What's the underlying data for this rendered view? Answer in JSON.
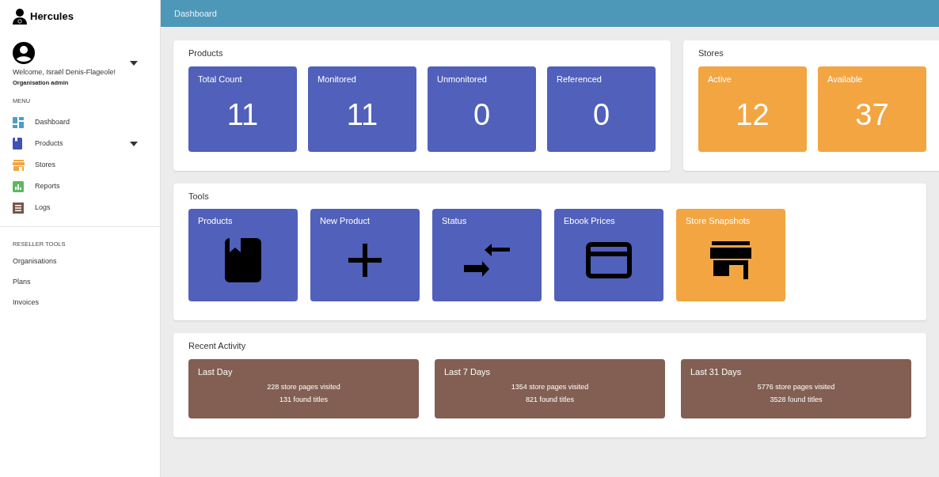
{
  "brand": "Hercules",
  "user": {
    "welcome": "Welcome, Israël Denis-Flageole!",
    "role": "Organisation admin"
  },
  "menu": {
    "heading": "MENU",
    "items": [
      {
        "label": "Dashboard",
        "has_submenu": false
      },
      {
        "label": "Products",
        "has_submenu": true
      },
      {
        "label": "Stores",
        "has_submenu": false
      },
      {
        "label": "Reports",
        "has_submenu": false
      },
      {
        "label": "Logs",
        "has_submenu": false
      }
    ]
  },
  "reseller": {
    "heading": "RESELLER TOOLS",
    "items": [
      "Organisations",
      "Plans",
      "Invoices"
    ]
  },
  "header": {
    "title": "Dashboard"
  },
  "products": {
    "title": "Products",
    "stats": [
      {
        "label": "Total Count",
        "value": "11"
      },
      {
        "label": "Monitored",
        "value": "11"
      },
      {
        "label": "Unmonitored",
        "value": "0"
      },
      {
        "label": "Referenced",
        "value": "0"
      }
    ]
  },
  "stores": {
    "title": "Stores",
    "stats": [
      {
        "label": "Active",
        "value": "12"
      },
      {
        "label": "Available",
        "value": "37"
      }
    ]
  },
  "tools": {
    "title": "Tools",
    "items": [
      {
        "label": "Products",
        "color": "#5060bb"
      },
      {
        "label": "New Product",
        "color": "#5060bb"
      },
      {
        "label": "Status",
        "color": "#5060bb"
      },
      {
        "label": "Ebook Prices",
        "color": "#5060bb"
      },
      {
        "label": "Store Snapshots",
        "color": "#f2a541"
      }
    ]
  },
  "activity": {
    "title": "Recent Activity",
    "items": [
      {
        "label": "Last Day",
        "pages": "228 store pages visited",
        "titles": "131 found titles"
      },
      {
        "label": "Last 7 Days",
        "pages": "1354 store pages visited",
        "titles": "821 found titles"
      },
      {
        "label": "Last 31 Days",
        "pages": "5776 store pages visited",
        "titles": "3528 found titles"
      }
    ]
  }
}
